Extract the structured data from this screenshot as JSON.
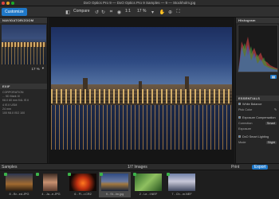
{
  "window": {
    "title": "DxO Optics Pro 9 — DxO Optics Pro 9 Samples — 9 — Stockholm.jpg"
  },
  "toolbar": {
    "tab_customize": "Customize",
    "compare_label": "Compare",
    "zoom_ratio": "1:1",
    "zoom_percent": "17 %"
  },
  "left_panel": {
    "navigator_title": "NAVIGATOR/ZOOM",
    "zoom_value": "17 %",
    "exif_title": "EXIF",
    "exif_lines": [
      "CORPORATION",
      "... 5D Mark III",
      "f/8.0 60 mm f/4L IS II",
      "4 IS II USM",
      "24 mm",
      "100 f/8.0 ISO 100",
      "",
      ""
    ]
  },
  "right_panel": {
    "histogram_title": "Histogram",
    "essentials_title": "ESSENTIALS",
    "white_balance": "White Balance",
    "pick_color": "Pick Color",
    "exposure_comp": "Exposure Compensation",
    "correction_label": "Correction",
    "correction_value": "Smart",
    "exposure_label": "Exposure",
    "smart_lighting": "DxO Smart Lighting",
    "mode_label": "Mode",
    "mode_value": "Slight"
  },
  "filmbar": {
    "project_label": "Samples",
    "count_label": "1/7 Images",
    "print_label": "Print",
    "export_label": "Export"
  },
  "filmstrip": [
    {
      "label": "8 - Br...ed.JPG"
    },
    {
      "label": "4 - Ja...e.JPG"
    },
    {
      "label": "6 - Fl...r.CR2"
    },
    {
      "label": "9 - St...lm.jpg"
    },
    {
      "label": "2 - Le...f.NEF"
    },
    {
      "label": "7 - Ch...m.NEF"
    }
  ],
  "colors": {
    "accent": "#1f78c8",
    "badge": "#3cb34a"
  }
}
